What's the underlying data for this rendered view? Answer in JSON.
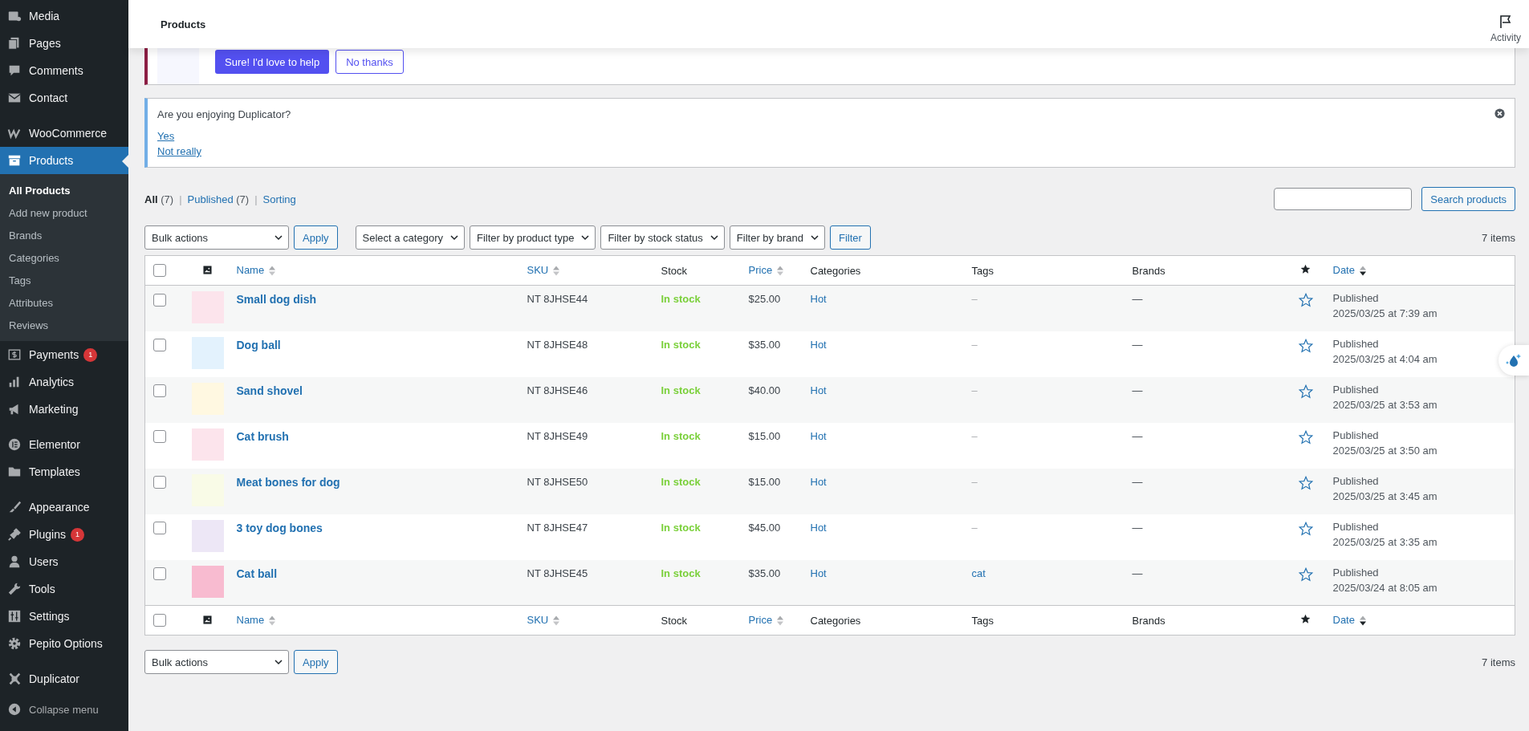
{
  "sidebar": {
    "groups": [
      [
        {
          "label": "Media",
          "selected": false
        },
        {
          "label": "Pages",
          "selected": false
        },
        {
          "label": "Comments",
          "selected": false
        },
        {
          "label": "Contact",
          "selected": false
        }
      ],
      [
        {
          "label": "WooCommerce",
          "selected": false
        },
        {
          "label": "Products",
          "selected": true,
          "children": [
            {
              "label": "All Products",
              "selected": true
            },
            {
              "label": "Add new product",
              "selected": false
            },
            {
              "label": "Brands",
              "selected": false
            },
            {
              "label": "Categories",
              "selected": false
            },
            {
              "label": "Tags",
              "selected": false
            },
            {
              "label": "Attributes",
              "selected": false
            },
            {
              "label": "Reviews",
              "selected": false
            }
          ]
        },
        {
          "label": "Payments",
          "selected": false,
          "badge": "1"
        },
        {
          "label": "Analytics",
          "selected": false
        },
        {
          "label": "Marketing",
          "selected": false
        }
      ],
      [
        {
          "label": "Elementor",
          "selected": false
        },
        {
          "label": "Templates",
          "selected": false
        }
      ],
      [
        {
          "label": "Appearance",
          "selected": false
        },
        {
          "label": "Plugins",
          "selected": false,
          "badge": "1"
        },
        {
          "label": "Users",
          "selected": false
        },
        {
          "label": "Tools",
          "selected": false
        },
        {
          "label": "Settings",
          "selected": false
        },
        {
          "label": "Pepito Options",
          "selected": false
        }
      ],
      [
        {
          "label": "Duplicator",
          "selected": false
        }
      ]
    ],
    "collapse_label": "Collapse menu"
  },
  "header": {
    "title": "Products",
    "activity": "Activity"
  },
  "notice_feedback": {
    "buttons": [
      "Sure! I'd love to help",
      "No thanks"
    ]
  },
  "notice_duplicator": {
    "question": "Are you enjoying Duplicator?",
    "links": [
      "Yes",
      "Not really"
    ]
  },
  "views": [
    {
      "label": "All",
      "count": "(7)",
      "selected": true
    },
    {
      "separator": "|",
      "label": "Published",
      "count": "(7)",
      "selected": false
    },
    {
      "separator": "|",
      "label": "Sorting",
      "selected": false
    }
  ],
  "search": {
    "button": "Search products"
  },
  "bulk_actions": {
    "value": "Bulk actions",
    "apply": "Apply"
  },
  "filters": [
    "Select a category",
    "Filter by product type",
    "Filter by stock status",
    "Filter by brand"
  ],
  "filter_button": "Filter",
  "items_count_top": "7 items",
  "table": {
    "select_all_checked": false,
    "columns": [
      {
        "label": "Name",
        "sortable": true,
        "sorted_desc": false
      },
      {
        "label": "SKU",
        "sortable": true,
        "sorted_desc": false
      },
      {
        "label": "Stock",
        "sortable": false
      },
      {
        "label": "Price",
        "sortable": true,
        "sorted_desc": false
      },
      {
        "label": "Categories",
        "sortable": false
      },
      {
        "label": "Tags",
        "sortable": false
      },
      {
        "label": "Brands",
        "sortable": false
      },
      {
        "label": "Date",
        "sortable": true,
        "sorted_desc": true
      }
    ],
    "footer_select_all_checked": false,
    "footer_columns": [
      {
        "label": "Name",
        "sortable": true,
        "sorted_desc": false
      },
      {
        "label": "SKU",
        "sortable": true,
        "sorted_desc": false
      },
      {
        "label": "Stock",
        "sortable": false
      },
      {
        "label": "Price",
        "sortable": true,
        "sorted_desc": false
      },
      {
        "label": "Categories",
        "sortable": false
      },
      {
        "label": "Tags",
        "sortable": false
      },
      {
        "label": "Brands",
        "sortable": false
      },
      {
        "label": "Date",
        "sortable": true,
        "sorted_desc": true
      }
    ],
    "rows": [
      {
        "checked": false,
        "name": "Small dog dish",
        "sku": "NT 8JHSE44",
        "stock": "In stock",
        "price": "$25.00",
        "category": "Hot",
        "tags": "–",
        "tags_linked": false,
        "brands": "—",
        "featured": false,
        "status": "Published",
        "date": "2025/03/25 at 7:39 am"
      },
      {
        "checked": false,
        "name": "Dog ball",
        "sku": "NT 8JHSE48",
        "stock": "In stock",
        "price": "$35.00",
        "category": "Hot",
        "tags": "–",
        "tags_linked": false,
        "brands": "—",
        "featured": false,
        "status": "Published",
        "date": "2025/03/25 at 4:04 am"
      },
      {
        "checked": false,
        "name": "Sand shovel",
        "sku": "NT 8JHSE46",
        "stock": "In stock",
        "price": "$40.00",
        "category": "Hot",
        "tags": "–",
        "tags_linked": false,
        "brands": "—",
        "featured": false,
        "status": "Published",
        "date": "2025/03/25 at 3:53 am"
      },
      {
        "checked": false,
        "name": "Cat brush",
        "sku": "NT 8JHSE49",
        "stock": "In stock",
        "price": "$15.00",
        "category": "Hot",
        "tags": "–",
        "tags_linked": false,
        "brands": "—",
        "featured": false,
        "status": "Published",
        "date": "2025/03/25 at 3:50 am"
      },
      {
        "checked": false,
        "name": "Meat bones for dog",
        "sku": "NT 8JHSE50",
        "stock": "In stock",
        "price": "$15.00",
        "category": "Hot",
        "tags": "–",
        "tags_linked": false,
        "brands": "—",
        "featured": false,
        "status": "Published",
        "date": "2025/03/25 at 3:45 am"
      },
      {
        "checked": false,
        "name": "3 toy dog bones",
        "sku": "NT 8JHSE47",
        "stock": "In stock",
        "price": "$45.00",
        "category": "Hot",
        "tags": "–",
        "tags_linked": false,
        "brands": "—",
        "featured": false,
        "status": "Published",
        "date": "2025/03/25 at 3:35 am"
      },
      {
        "checked": false,
        "name": "Cat ball",
        "sku": "NT 8JHSE45",
        "stock": "In stock",
        "price": "$35.00",
        "category": "Hot",
        "tags": "cat",
        "tags_linked": true,
        "brands": "—",
        "featured": false,
        "status": "Published",
        "date": "2025/03/24 at 8:05 am"
      }
    ]
  },
  "bulk_actions_bottom": {
    "value": "Bulk actions",
    "apply": "Apply"
  },
  "items_count_bottom": "7 items"
}
